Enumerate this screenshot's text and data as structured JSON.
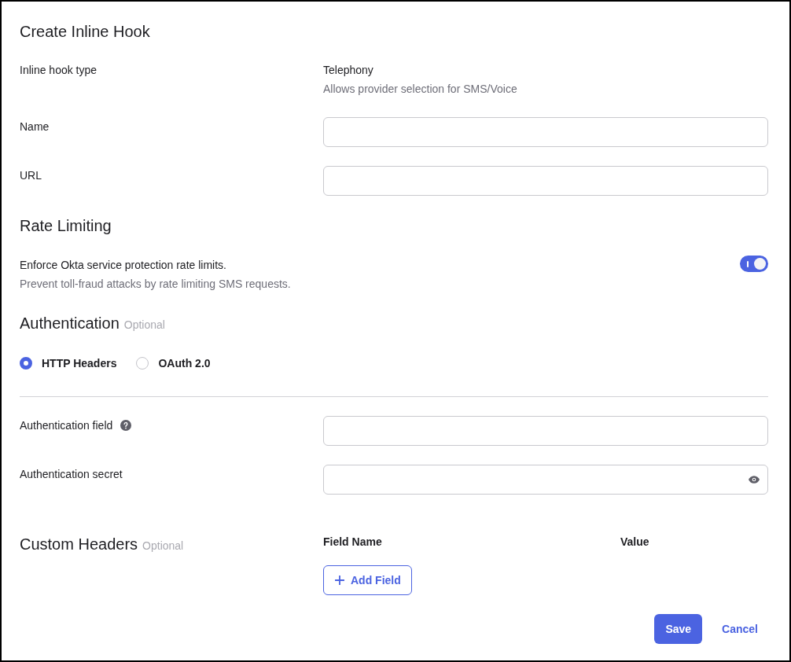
{
  "title": "Create Inline Hook",
  "fields": [
    {
      "kind": "static",
      "label": "Inline hook type",
      "value": "Telephony",
      "description": "Allows provider selection for SMS/Voice"
    },
    {
      "kind": "input",
      "label": "Name"
    },
    {
      "kind": "input",
      "label": "URL"
    }
  ],
  "rate_limiting": {
    "heading": "Rate Limiting",
    "toggle": {
      "label": "Enforce Okta service protection rate limits.",
      "description": "Prevent toll-fraud attacks by rate limiting SMS requests.",
      "on": true
    }
  },
  "authentication": {
    "heading": "Authentication",
    "optional": "Optional",
    "options": [
      {
        "label": "HTTP Headers",
        "selected": true
      },
      {
        "label": "OAuth 2.0",
        "selected": false
      }
    ],
    "fields": [
      {
        "kind": "text",
        "label": "Authentication field",
        "help": true
      },
      {
        "kind": "secret",
        "label": "Authentication secret",
        "help": false
      }
    ]
  },
  "custom_headers": {
    "heading": "Custom Headers",
    "optional": "Optional",
    "columns": [
      "Field Name",
      "Value"
    ],
    "add_button": "Add Field"
  },
  "actions": [
    {
      "kind": "primary",
      "label": "Save"
    },
    {
      "kind": "link",
      "label": "Cancel"
    }
  ]
}
